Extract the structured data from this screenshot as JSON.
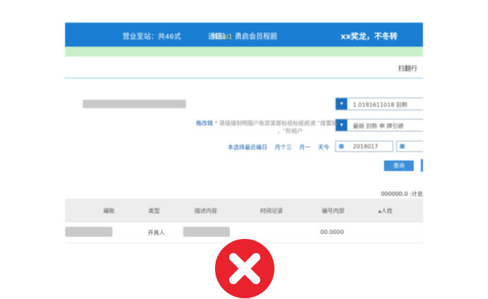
{
  "topbar": {
    "logo": "xx奖龙，不冬转",
    "nav_1": "体验",
    "nav_highlight": "1",
    "nav_1b": "勇启会员程题",
    "nav_2": "退伍",
    "nav_2_accent": "ai",
    "nav_3": "营业至站：共46式"
  },
  "breadcrumb": "扫翻行",
  "filters": {
    "account_select": "1.0181611018 别称",
    "account_select_btn": "▾",
    "type_select": "最辦 别称 申 牌引绩",
    "type_select_btn": "▾",
    "hint_text": "* 逐级操制明服户账部某那标纸标纸纸请 “按置辑",
    "hint_text_2": "。“阶组户",
    "hint_link": "格改辑",
    "date_value": "2018017",
    "date_icon_left": "▦",
    "date_icon_right": "▦"
  },
  "shortcuts": [
    "天今",
    "月一",
    "月个三",
    "本选择最近编日"
  ],
  "query_button": "查询",
  "summary": "000000.0 :计总",
  "table": {
    "headers": [
      "人姓",
      "编号内部",
      "时间记录",
      "描述内容",
      "类型",
      "编账"
    ],
    "sort_icon": "▴",
    "row": {
      "amount": "00.0000",
      "name": "开具人"
    }
  },
  "status_icon": "error-x-icon",
  "colors": {
    "topbar": "#1a7fd2",
    "notice": "#c9f0c9",
    "error": "#e8232b"
  }
}
